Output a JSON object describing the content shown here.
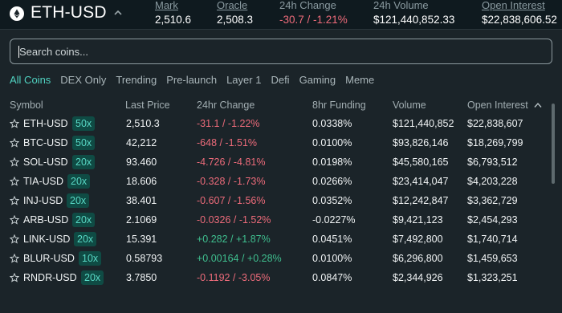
{
  "header": {
    "pair": "ETH-USD",
    "stats": [
      {
        "label": "Mark",
        "value": "2,510.6",
        "underline": true
      },
      {
        "label": "Oracle",
        "value": "2,508.3",
        "underline": true
      },
      {
        "label": "24h Change",
        "value": "-30.7 / -1.21%",
        "underline": false
      },
      {
        "label": "24h Volume",
        "value": "$121,440,852.33",
        "underline": false
      },
      {
        "label": "Open Interest",
        "value": "$22,838,606.52",
        "underline": true
      }
    ]
  },
  "search": {
    "placeholder": "Search coins..."
  },
  "filters": [
    "All Coins",
    "DEX Only",
    "Trending",
    "Pre-launch",
    "Layer 1",
    "Defi",
    "Gaming",
    "Meme"
  ],
  "active_filter": "All Coins",
  "columns": [
    "Symbol",
    "Last Price",
    "24hr Change",
    "8hr Funding",
    "Volume",
    "Open Interest"
  ],
  "sort": {
    "column": "Open Interest",
    "direction": "desc"
  },
  "colors": {
    "accent": "#50d2c1",
    "negative": "#ed6b7a",
    "positive": "#3fbf8f",
    "badge_bg": "#0f4b44"
  },
  "rows": [
    {
      "symbol": "ETH-USD",
      "leverage": "50x",
      "last": "2,510.3",
      "change": "-31.1 / -1.22%",
      "dir": "neg",
      "funding": "0.0338%",
      "volume": "$121,440,852",
      "oi": "$22,838,607"
    },
    {
      "symbol": "BTC-USD",
      "leverage": "50x",
      "last": "42,212",
      "change": "-648 / -1.51%",
      "dir": "neg",
      "funding": "0.0100%",
      "volume": "$93,826,146",
      "oi": "$18,269,799"
    },
    {
      "symbol": "SOL-USD",
      "leverage": "20x",
      "last": "93.460",
      "change": "-4.726 / -4.81%",
      "dir": "neg",
      "funding": "0.0198%",
      "volume": "$45,580,165",
      "oi": "$6,793,512"
    },
    {
      "symbol": "TIA-USD",
      "leverage": "20x",
      "last": "18.606",
      "change": "-0.328 / -1.73%",
      "dir": "neg",
      "funding": "0.0266%",
      "volume": "$23,414,047",
      "oi": "$4,203,228"
    },
    {
      "symbol": "INJ-USD",
      "leverage": "20x",
      "last": "38.401",
      "change": "-0.607 / -1.56%",
      "dir": "neg",
      "funding": "0.0352%",
      "volume": "$12,242,847",
      "oi": "$3,362,729"
    },
    {
      "symbol": "ARB-USD",
      "leverage": "20x",
      "last": "2.1069",
      "change": "-0.0326 / -1.52%",
      "dir": "neg",
      "funding": "-0.0227%",
      "volume": "$9,421,123",
      "oi": "$2,454,293"
    },
    {
      "symbol": "LINK-USD",
      "leverage": "20x",
      "last": "15.391",
      "change": "+0.282 / +1.87%",
      "dir": "pos",
      "funding": "0.0451%",
      "volume": "$7,492,800",
      "oi": "$1,740,714"
    },
    {
      "symbol": "BLUR-USD",
      "leverage": "10x",
      "last": "0.58793",
      "change": "+0.00164 / +0.28%",
      "dir": "pos",
      "funding": "0.0100%",
      "volume": "$6,296,800",
      "oi": "$1,459,653"
    },
    {
      "symbol": "RNDR-USD",
      "leverage": "20x",
      "last": "3.7850",
      "change": "-0.1192 / -3.05%",
      "dir": "neg",
      "funding": "0.0847%",
      "volume": "$2,344,926",
      "oi": "$1,323,251"
    }
  ]
}
